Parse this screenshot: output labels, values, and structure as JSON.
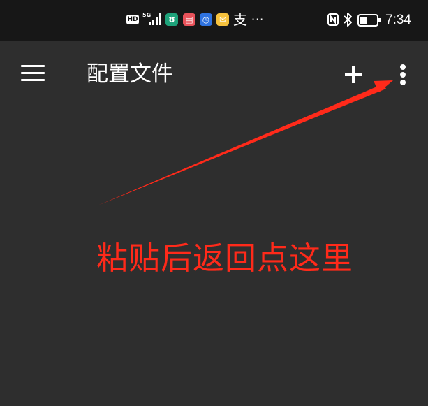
{
  "status_bar": {
    "hd_badge": "HD",
    "network_type": "5G",
    "app_notifications": [
      {
        "icon": "mi-app-icon",
        "glyph": "ʊ",
        "color": "#1ea27a"
      },
      {
        "icon": "book-app-icon",
        "glyph": "▤",
        "color": "#e9525a"
      },
      {
        "icon": "clock-app-icon",
        "glyph": "◷",
        "color": "#2f73e0"
      },
      {
        "icon": "mail-app-icon",
        "glyph": "✉",
        "color": "#f6c23d"
      }
    ],
    "alipay_glyph": "支",
    "more_notifications": "···",
    "time": "7:34"
  },
  "app_bar": {
    "title": "配置文件",
    "add_icon": "plus-icon",
    "menu_icon": "menu-icon",
    "overflow_icon": "more-vert-icon"
  },
  "annotation": {
    "text": "粘贴后返回点这里",
    "color": "#ff2a1a"
  }
}
